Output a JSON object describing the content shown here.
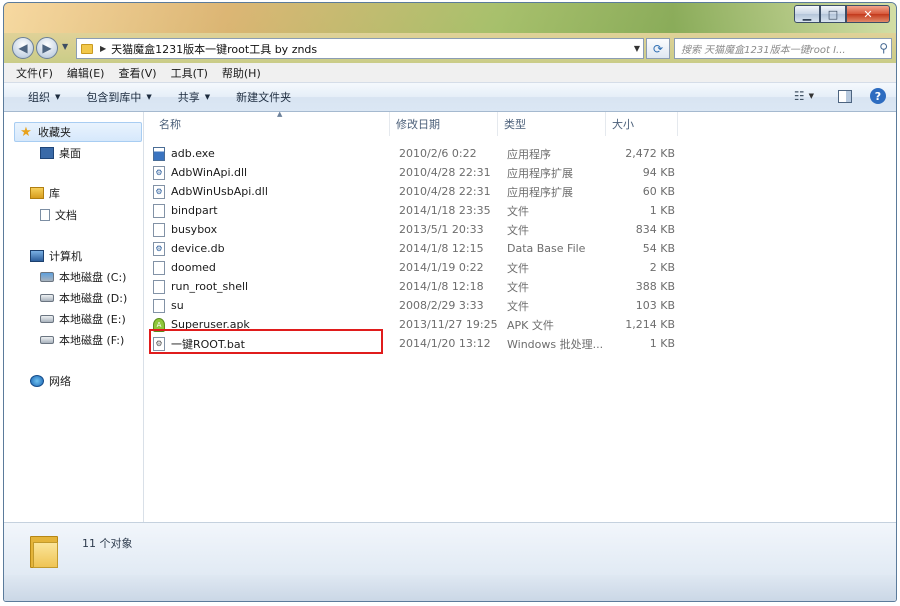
{
  "window": {
    "caption_minimize": "▁",
    "caption_maximize": "□",
    "caption_close": "✕"
  },
  "address": {
    "path": "天猫魔盒1231版本一键root工具 by znds",
    "search_placeholder": "搜索 天猫魔盒1231版本一键root I..."
  },
  "menu": [
    "文件(F)",
    "编辑(E)",
    "查看(V)",
    "工具(T)",
    "帮助(H)"
  ],
  "commands": [
    {
      "label": "组织",
      "caret": true
    },
    {
      "label": "包含到库中",
      "caret": true
    },
    {
      "label": "共享",
      "caret": true
    },
    {
      "label": "新建文件夹",
      "caret": false
    }
  ],
  "nav": {
    "favorites": "收藏夹",
    "desktop": "桌面",
    "libraries": "库",
    "documents": "文档",
    "computer": "计算机",
    "drive_c": "本地磁盘 (C:)",
    "drive_d": "本地磁盘 (D:)",
    "drive_e": "本地磁盘 (E:)",
    "drive_f": "本地磁盘 (F:)",
    "network": "网络"
  },
  "columns": {
    "name": "名称",
    "date": "修改日期",
    "type": "类型",
    "size": "大小"
  },
  "files": [
    {
      "name": "adb.exe",
      "date": "2010/2/6 0:22",
      "type": "应用程序",
      "size": "2,472 KB",
      "icon": "exe-icon"
    },
    {
      "name": "AdbWinApi.dll",
      "date": "2010/4/28 22:31",
      "type": "应用程序扩展",
      "size": "94 KB",
      "icon": "dll-icon"
    },
    {
      "name": "AdbWinUsbApi.dll",
      "date": "2010/4/28 22:31",
      "type": "应用程序扩展",
      "size": "60 KB",
      "icon": "dll-icon"
    },
    {
      "name": "bindpart",
      "date": "2014/1/18 23:35",
      "type": "文件",
      "size": "1 KB",
      "icon": "file-icon"
    },
    {
      "name": "busybox",
      "date": "2013/5/1 20:33",
      "type": "文件",
      "size": "834 KB",
      "icon": "file-icon"
    },
    {
      "name": "device.db",
      "date": "2014/1/8 12:15",
      "type": "Data Base File",
      "size": "54 KB",
      "icon": "db-icon"
    },
    {
      "name": "doomed",
      "date": "2014/1/19 0:22",
      "type": "文件",
      "size": "2 KB",
      "icon": "file-icon"
    },
    {
      "name": "run_root_shell",
      "date": "2014/1/8 12:18",
      "type": "文件",
      "size": "388 KB",
      "icon": "file-icon"
    },
    {
      "name": "su",
      "date": "2008/2/29 3:33",
      "type": "文件",
      "size": "103 KB",
      "icon": "file-icon"
    },
    {
      "name": "Superuser.apk",
      "date": "2013/11/27 19:25",
      "type": "APK 文件",
      "size": "1,214 KB",
      "icon": "apk-icon"
    },
    {
      "name": "一键ROOT.bat",
      "date": "2014/1/20 13:12",
      "type": "Windows 批处理...",
      "size": "1 KB",
      "icon": "bat-icon"
    }
  ],
  "status": {
    "item_count": "11 个对象"
  },
  "colors": {
    "highlight": "#e01c1c"
  }
}
